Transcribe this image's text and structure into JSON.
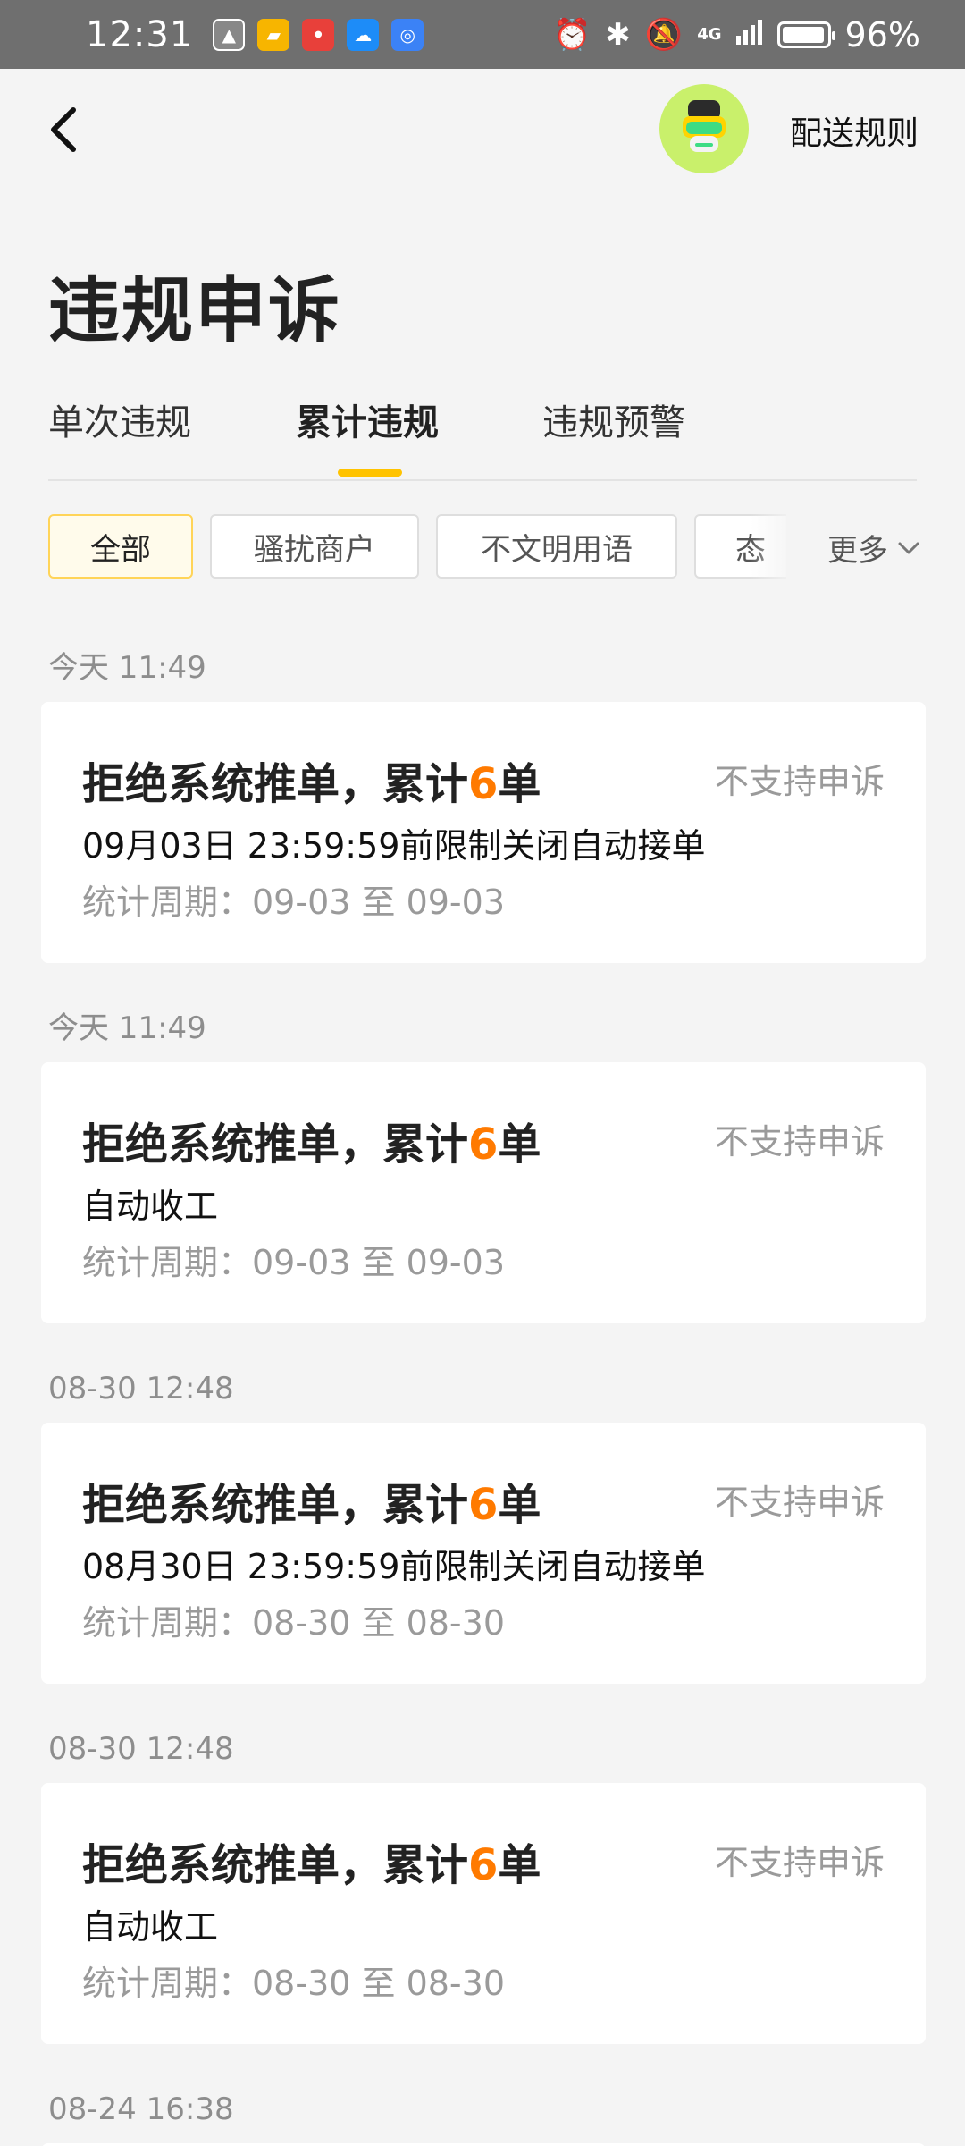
{
  "status_bar": {
    "time": "12:31",
    "network": "4G",
    "battery_text": "96%",
    "battery_level": 0.96
  },
  "header": {
    "back_icon": "chevron-left-icon",
    "rules_label": "配送规则",
    "title": "违规申诉"
  },
  "tabs": [
    {
      "label": "单次违规"
    },
    {
      "label": "累计违规"
    },
    {
      "label": "违规预警"
    }
  ],
  "filters": {
    "chips": [
      {
        "label": "全部"
      },
      {
        "label": "骚扰商户"
      },
      {
        "label": "不文明用语"
      },
      {
        "label": "态"
      }
    ],
    "more_label": "更多"
  },
  "records": [
    {
      "date": "今天 11:49",
      "title_prefix": "拒绝系统推单，累计",
      "count": "6",
      "title_suffix": "单",
      "status": "不支持申诉",
      "desc": "09月03日 23:59:59前限制关闭自动接单",
      "period": "统计周期：09-03 至 09-03"
    },
    {
      "date": "今天 11:49",
      "title_prefix": "拒绝系统推单，累计",
      "count": "6",
      "title_suffix": "单",
      "status": "不支持申诉",
      "desc": "自动收工",
      "period": "统计周期：09-03 至 09-03"
    },
    {
      "date": "08-30 12:48",
      "title_prefix": "拒绝系统推单，累计",
      "count": "6",
      "title_suffix": "单",
      "status": "不支持申诉",
      "desc": "08月30日 23:59:59前限制关闭自动接单",
      "period": "统计周期：08-30 至 08-30"
    },
    {
      "date": "08-30 12:48",
      "title_prefix": "拒绝系统推单，累计",
      "count": "6",
      "title_suffix": "单",
      "status": "不支持申诉",
      "desc": "自动收工",
      "period": "统计周期：08-30 至 08-30"
    }
  ],
  "next_date": "08-24 16:38",
  "colors": {
    "accent": "#ffc300",
    "count_highlight": "#ff7a00",
    "status_bar": "#6f6f6f",
    "background": "#f4f4f4"
  }
}
